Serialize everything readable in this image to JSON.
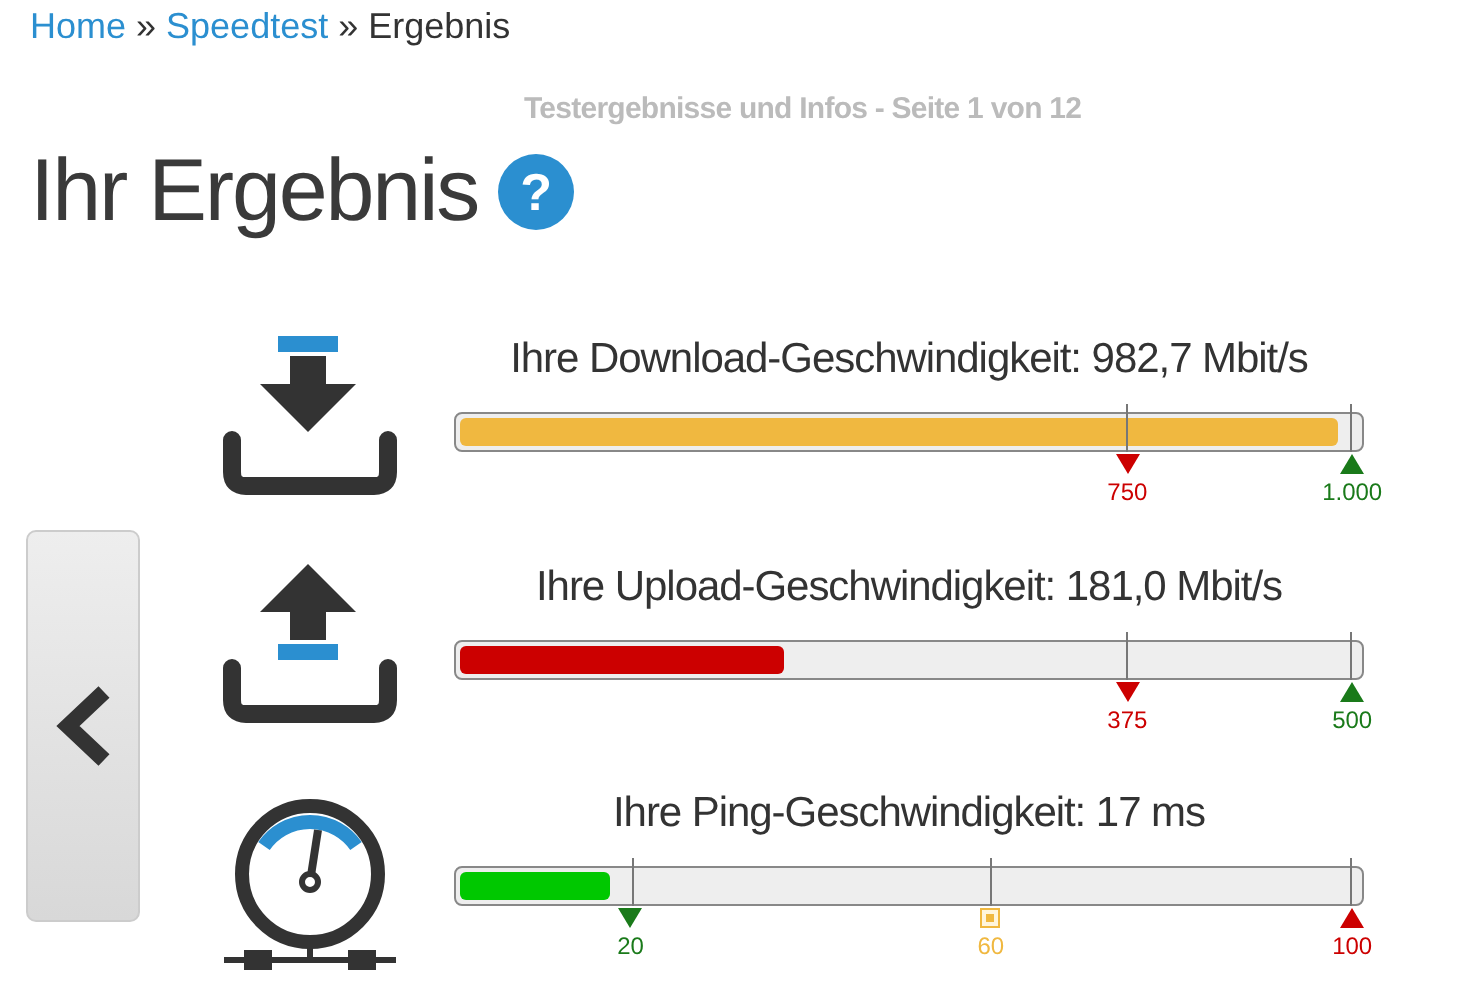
{
  "breadcrumb": [
    {
      "label": "Home",
      "kind": "link"
    },
    {
      "label": "»",
      "kind": "separator"
    },
    {
      "label": "Speedtest",
      "kind": "link"
    },
    {
      "label": "»",
      "kind": "separator"
    },
    {
      "label": "Ergebnis",
      "kind": "current"
    }
  ],
  "subtitle": "Testergebnisse und Infos - Seite 1 von 12",
  "heading": "Ihr Ergebnis",
  "help_icon": "?",
  "results": [
    {
      "kind": "download",
      "title": "Ihre Download-Geschwindigkeit: 982,7 Mbit/s",
      "level": 0.977,
      "color": "#f0b840",
      "markers": [
        {
          "label": "750",
          "level": 0.74,
          "kind": "down",
          "color": "#cc0000"
        },
        {
          "label": "1.000",
          "level": 0.987,
          "kind": "up",
          "color": "#1a7a1a"
        }
      ]
    },
    {
      "kind": "upload",
      "title": "Ihre Upload-Geschwindigkeit: 181,0 Mbit/s",
      "level": 0.36,
      "color": "#cc0000",
      "markers": [
        {
          "label": "375",
          "level": 0.74,
          "kind": "down",
          "color": "#cc0000"
        },
        {
          "label": "500",
          "level": 0.987,
          "kind": "up",
          "color": "#1a7a1a"
        }
      ]
    },
    {
      "kind": "ping",
      "title": "Ihre Ping-Geschwindigkeit: 17 ms",
      "level": 0.168,
      "color": "#00c800",
      "markers": [
        {
          "label": "20",
          "level": 0.194,
          "kind": "down",
          "color": "#1a7a1a"
        },
        {
          "label": "60",
          "level": 0.59,
          "kind": "square",
          "color": "#f0b840"
        },
        {
          "label": "100",
          "level": 0.987,
          "kind": "up",
          "color": "#cc0000"
        }
      ]
    }
  ]
}
